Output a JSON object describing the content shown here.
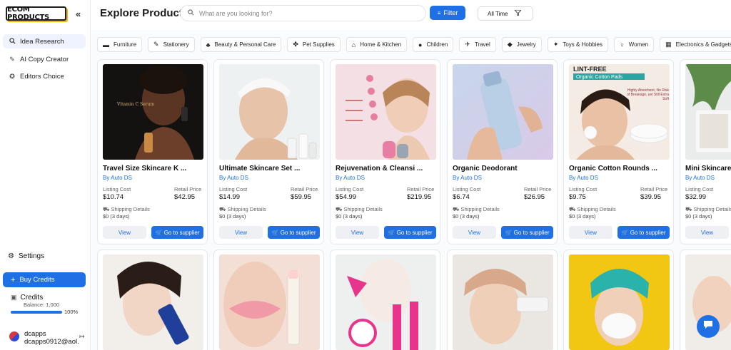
{
  "sidebar": {
    "logo": "ECOM PRODUCTS",
    "nav": [
      {
        "label": "Idea Research",
        "icon": "search-icon"
      },
      {
        "label": "AI Copy Creator",
        "icon": "magic-wand-icon"
      },
      {
        "label": "Editors Choice",
        "icon": "badge-icon"
      }
    ],
    "settings": "Settings",
    "buy_credits": "Buy Credits",
    "credits_title": "Credits",
    "credits_balance": "Balance: 1,000",
    "credits_pct": "100%",
    "credits_fraction": 1.0,
    "user_name": "dcapps",
    "user_email": "dcapps0912@aol."
  },
  "header": {
    "title": "Explore Products",
    "search_placeholder": "What are you looking for?",
    "filter": "Filter",
    "time": "All Time"
  },
  "categories": [
    {
      "label": "Furniture",
      "icon": "sofa-icon"
    },
    {
      "label": "Stationery",
      "icon": "pen-icon"
    },
    {
      "label": "Beauty & Personal Care",
      "icon": "beauty-icon"
    },
    {
      "label": "Pet Supplies",
      "icon": "paw-icon"
    },
    {
      "label": "Home & Kitchen",
      "icon": "home-icon"
    },
    {
      "label": "Children",
      "icon": "child-icon"
    },
    {
      "label": "Travel",
      "icon": "plane-icon"
    },
    {
      "label": "Jewelry",
      "icon": "gem-icon"
    },
    {
      "label": "Toys & Hobbies",
      "icon": "toy-icon"
    },
    {
      "label": "Women",
      "icon": "woman-icon"
    },
    {
      "label": "Electronics & Gadgets",
      "icon": "chip-icon"
    }
  ],
  "labels": {
    "by": "By",
    "listing_cost": "Listing Cost",
    "retail_price": "Retail Price",
    "shipping_details": "Shipping Details",
    "view": "View",
    "go_to_supplier": "Go to supplier"
  },
  "products": [
    {
      "name": "Travel Size Skincare K ...",
      "vendor": "Auto DS",
      "listing_cost": "$10.74",
      "retail_price": "$42.95",
      "shipping": "$0  (3 days)",
      "image_text": "Vitamin C Serum"
    },
    {
      "name": "Ultimate Skincare Set ...",
      "vendor": "Auto DS",
      "listing_cost": "$14.99",
      "retail_price": "$59.95",
      "shipping": "$0  (3 days)"
    },
    {
      "name": "Rejuvenation & Cleansi ...",
      "vendor": "Auto DS",
      "listing_cost": "$54.99",
      "retail_price": "$219.95",
      "shipping": "$0  (3 days)"
    },
    {
      "name": "Organic Deodorant",
      "vendor": "Auto DS",
      "listing_cost": "$6.74",
      "retail_price": "$26.95",
      "shipping": "$0  (3 days)"
    },
    {
      "name": "Organic Cotton Rounds ...",
      "vendor": "Auto DS",
      "listing_cost": "$9.75",
      "retail_price": "$39.95",
      "shipping": "$0  (3 days)",
      "image_text": "LINT-FREE",
      "image_text2": "Organic Cotton Pads",
      "image_text3": "Highly Absorbent, No Risk of Breakage, yet Still Extra Soft"
    },
    {
      "name": "Mini Skincare",
      "vendor": "Auto DS",
      "listing_cost": "$32.99",
      "retail_price": "",
      "shipping": "$0  (3 days)"
    }
  ]
}
